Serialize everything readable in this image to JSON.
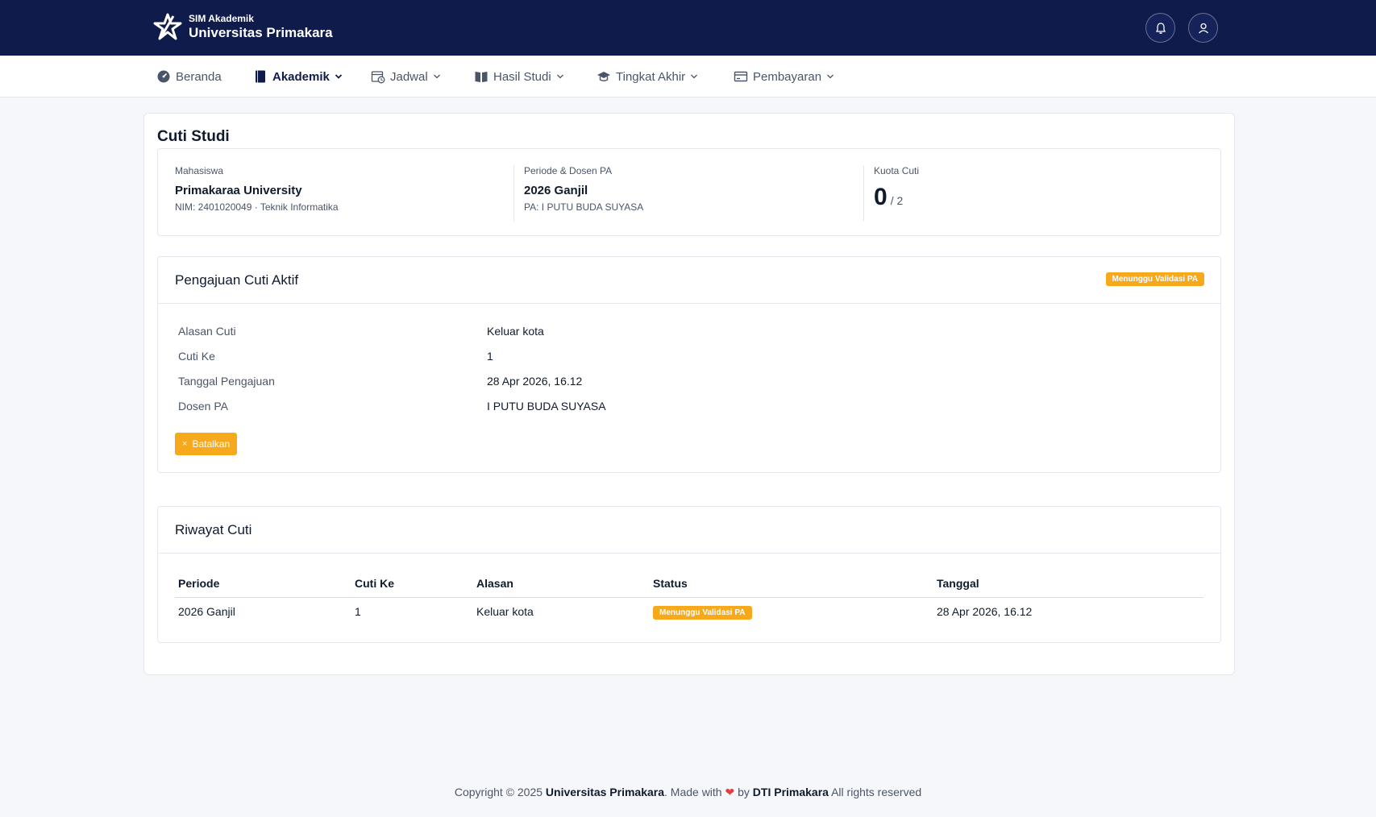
{
  "header": {
    "subtitle": "SIM Akademik",
    "title": "Universitas Primakara"
  },
  "nav": {
    "items": [
      {
        "label": "Beranda"
      },
      {
        "label": "Akademik"
      },
      {
        "label": "Jadwal"
      },
      {
        "label": "Hasil Studi"
      },
      {
        "label": "Tingkat Akhir"
      },
      {
        "label": "Pembayaran"
      }
    ]
  },
  "page": {
    "title": "Cuti Studi"
  },
  "info": {
    "student_label": "Mahasiswa",
    "student_name": "Primakaraa University",
    "student_sub": "NIM: 2401020049 · Teknik Informatika",
    "period_label": "Periode & Dosen PA",
    "period_value": "2026 Ganjil",
    "period_sub": "PA: I PUTU BUDA SUYASA",
    "quota_label": "Kuota Cuti",
    "quota_used": "0",
    "quota_total": "/ 2"
  },
  "active": {
    "title": "Pengajuan Cuti Aktif",
    "status": "Menunggu Validasi PA",
    "rows": [
      {
        "label": "Alasan Cuti",
        "value": "Keluar kota"
      },
      {
        "label": "Cuti Ke",
        "value": "1"
      },
      {
        "label": "Tanggal Pengajuan",
        "value": "28 Apr 2026, 16.12"
      },
      {
        "label": "Dosen PA",
        "value": "I PUTU BUDA SUYASA"
      }
    ],
    "cancel_icon": "×",
    "cancel_label": "Batalkan"
  },
  "history": {
    "title": "Riwayat Cuti",
    "columns": [
      "Periode",
      "Cuti Ke",
      "Alasan",
      "Status",
      "Tanggal"
    ],
    "rows": [
      {
        "period": "2026 Ganjil",
        "number": "1",
        "reason": "Keluar kota",
        "status": "Menunggu Validasi PA",
        "date": "28 Apr 2026, 16.12"
      }
    ]
  },
  "footer": {
    "prefix": "Copyright © 2025",
    "org": "Universitas Primakara",
    "made_with": ". Made with",
    "by": "by",
    "team": "DTI Primakara",
    "suffix": "All rights reserved"
  },
  "colors": {
    "header_bg": "#0f1b4a",
    "badge": "#f7a91c",
    "heart": "#e53e3e"
  },
  "icons": {
    "notification": "bell-icon",
    "profile": "user-icon"
  }
}
